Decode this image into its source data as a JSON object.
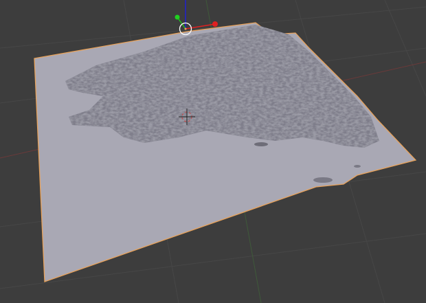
{
  "viewport": {
    "type": "3d-viewport",
    "background_color": "#3d3d3d",
    "grid_color": "#474747",
    "x_axis_color": "#6b3a3a",
    "y_axis_color": "#3f5a3a"
  },
  "object": {
    "kind": "terrain-plane-mesh",
    "selected": true,
    "surface_color": "#a9a8b4",
    "outline_color": "#e8a25a"
  },
  "gizmo": {
    "icons": [
      "transform-gizmo-icon",
      "3d-cursor-icon"
    ],
    "x_color": "#e02020",
    "y_color": "#20c020",
    "z_color": "#2020d0"
  }
}
